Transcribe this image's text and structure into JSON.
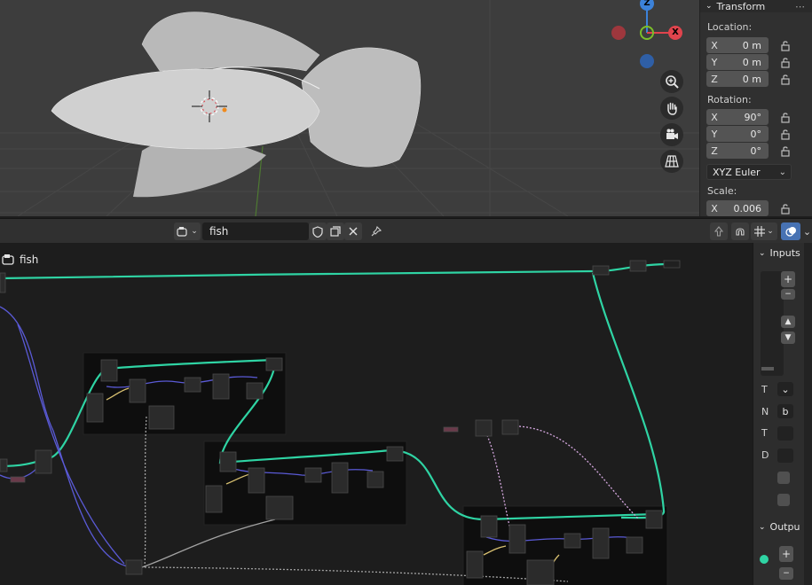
{
  "viewport": {
    "gizmo": {
      "z_label": "Z",
      "x_label": "X"
    },
    "nav_icons": [
      "zoom-icon",
      "hand-pan-icon",
      "camera-icon",
      "grid-ortho-icon"
    ]
  },
  "npanel": {
    "section_title": "Transform",
    "location_label": "Location:",
    "location": [
      {
        "axis": "X",
        "value": "0 m"
      },
      {
        "axis": "Y",
        "value": "0 m"
      },
      {
        "axis": "Z",
        "value": "0 m"
      }
    ],
    "rotation_label": "Rotation:",
    "rotation": [
      {
        "axis": "X",
        "value": "90°"
      },
      {
        "axis": "Y",
        "value": "0°"
      },
      {
        "axis": "Z",
        "value": "0°"
      }
    ],
    "rotation_mode": "XYZ Euler",
    "scale_label": "Scale:",
    "scale": [
      {
        "axis": "X",
        "value": "0.006"
      }
    ]
  },
  "node_editor": {
    "tree_name": "fish",
    "breadcrumb": "fish"
  },
  "sidebar": {
    "inputs_title": "Inputs",
    "outputs_title": "Outpu",
    "rows": [
      {
        "label": "T",
        "box": "⌄"
      },
      {
        "label": "N",
        "box": "b"
      },
      {
        "label": "T",
        "box": ""
      },
      {
        "label": "D",
        "box": ""
      }
    ]
  },
  "colors": {
    "geometry_link": "#2fd4a4",
    "vector_link": "#5a5ad6",
    "float_link": "#a3a3a3",
    "shader_link": "#d6a8e0",
    "yellow_link": "#d8c070",
    "gizmo_x": "#e0444d",
    "gizmo_y": "#7bbf2a",
    "gizmo_z": "#3c82d9"
  }
}
